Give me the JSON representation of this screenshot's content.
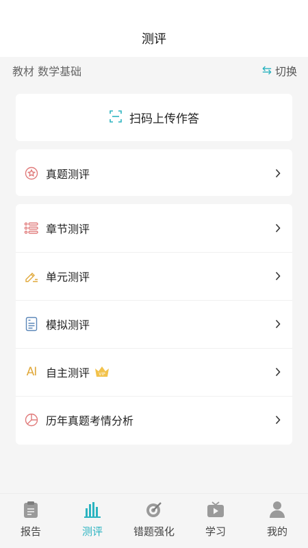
{
  "header": {
    "title": "测评"
  },
  "textbook": {
    "label": "教材 数学基础",
    "switch_label": "切换",
    "switch_icon": "swap-arrows-icon"
  },
  "scan": {
    "label": "扫码上传作答",
    "icon": "scan-code-icon"
  },
  "sections": [
    {
      "label": "真题测评",
      "icon": "star-circle-icon"
    }
  ],
  "list": [
    {
      "label": "章节测评",
      "icon": "list-bullets-icon"
    },
    {
      "label": "单元测评",
      "icon": "pencil-icon"
    },
    {
      "label": "模拟测评",
      "icon": "document-icon"
    },
    {
      "label": "自主测评",
      "icon": "ai-text-icon",
      "ai_text": "AI",
      "badge": "VIP"
    },
    {
      "label": "历年真题考情分析",
      "icon": "pie-chart-icon"
    }
  ],
  "tabs": [
    {
      "label": "报告",
      "icon": "clipboard-icon",
      "active": false
    },
    {
      "label": "测评",
      "icon": "bar-chart-icon",
      "active": true
    },
    {
      "label": "错题强化",
      "icon": "target-pen-icon",
      "active": false
    },
    {
      "label": "学习",
      "icon": "tv-play-icon",
      "active": false
    },
    {
      "label": "我的",
      "icon": "user-icon",
      "active": false
    }
  ],
  "colors": {
    "accent": "#2bb3c0",
    "icon_red": "#e07a7a",
    "icon_gold": "#e0a83a",
    "icon_blue": "#5a86b8",
    "tab_gray": "#9a9a9a"
  }
}
